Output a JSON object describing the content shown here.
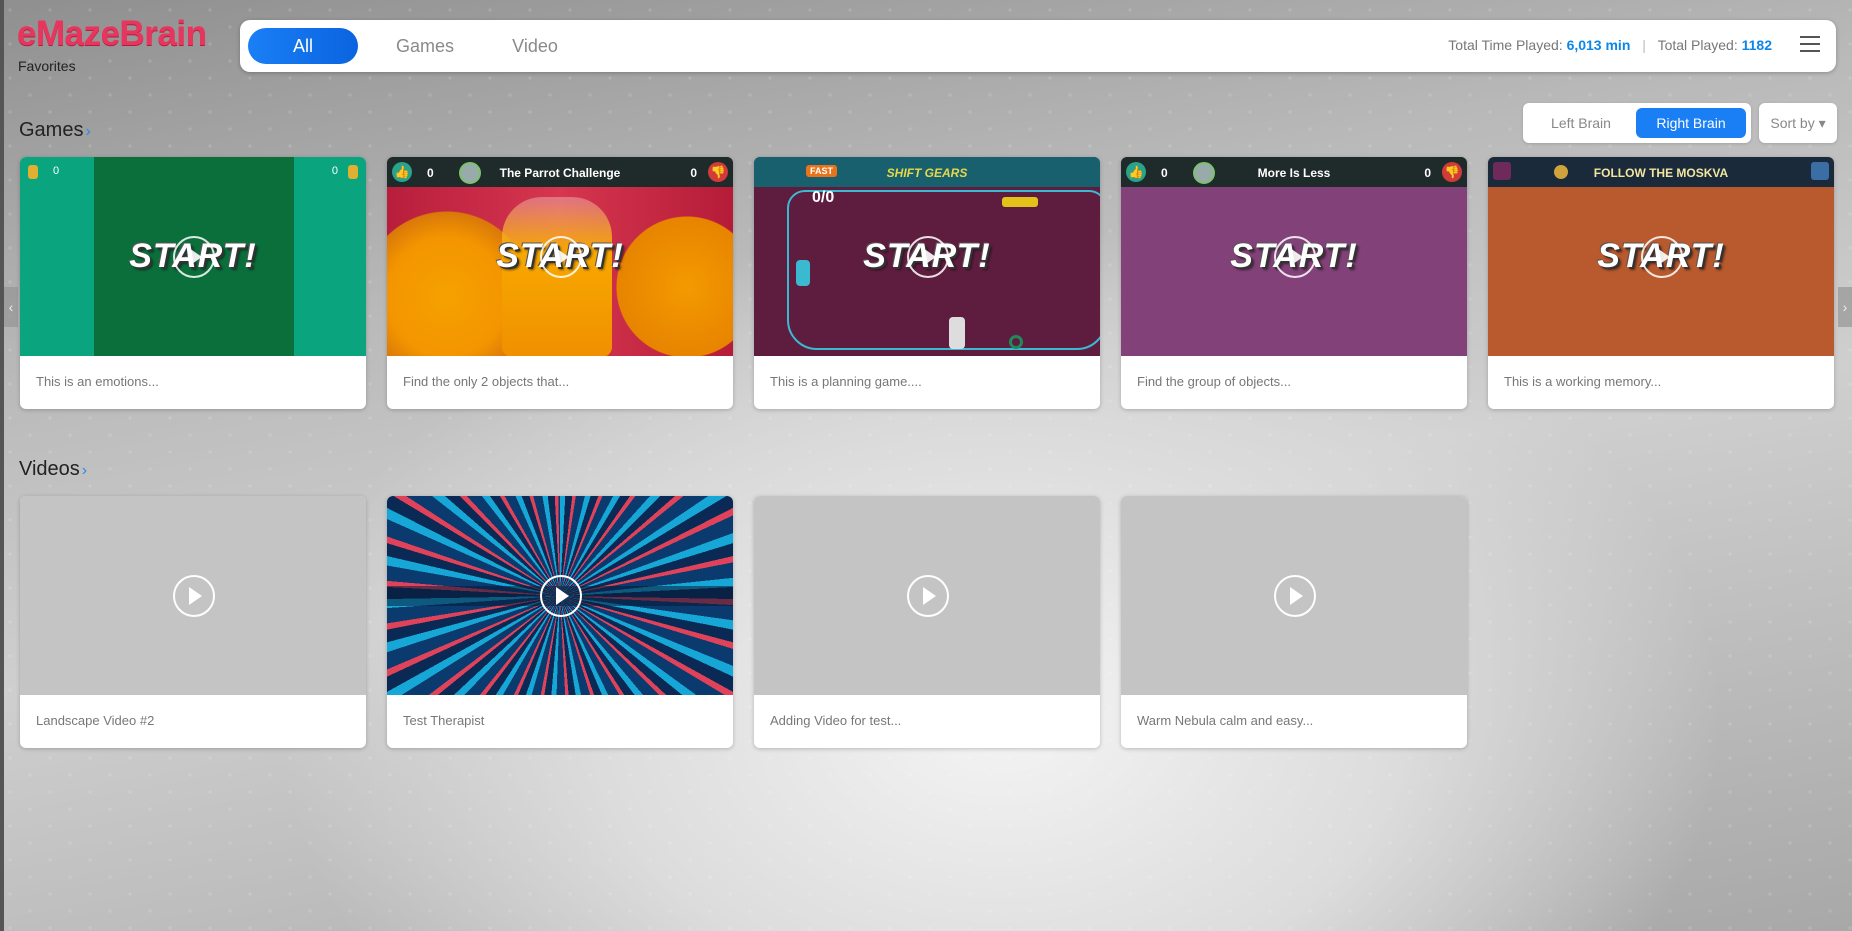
{
  "brand": {
    "logo": "eMazeBrain",
    "subtitle": "Favorites",
    "accent": "#e8355d",
    "primary": "#1a7ff5"
  },
  "nav": {
    "tabs": [
      {
        "label": "All",
        "active": true
      },
      {
        "label": "Games",
        "active": false
      },
      {
        "label": "Video",
        "active": false
      }
    ]
  },
  "stats": {
    "time_label": "Total Time Played:",
    "time_value": "6,013 min",
    "played_label": "Total Played:",
    "played_value": "1182",
    "menu_icon": "hamburger-menu-icon"
  },
  "games": {
    "title": "Games",
    "filters": {
      "left": "Left Brain",
      "right": "Right Brain",
      "active": "Right Brain"
    },
    "sort_label": "Sort by",
    "items": [
      {
        "caption": "This is an emotions...",
        "bar_title": "",
        "left_count": "0",
        "right_count": "0",
        "start": "START!"
      },
      {
        "caption": "Find the only 2 objects that...",
        "bar_title": "The Parrot Challenge",
        "left_count": "0",
        "right_count": "0",
        "start": "START!"
      },
      {
        "caption": "This is a planning game....",
        "bar_title": "SHIFT GEARS",
        "left_count": "",
        "right_count": "",
        "start": "START!",
        "badge": "FAST",
        "counter": "0/0"
      },
      {
        "caption": "Find the group of objects...",
        "bar_title": "More Is Less",
        "left_count": "0",
        "right_count": "0",
        "start": "START!"
      },
      {
        "caption": "This is a working memory...",
        "bar_title": "FOLLOW THE MOSKVA",
        "left_count": "",
        "right_count": "",
        "start": "START!"
      }
    ]
  },
  "videos": {
    "title": "Videos",
    "items": [
      {
        "caption": "Landscape Video #2"
      },
      {
        "caption": "Test Therapist"
      },
      {
        "caption": "Adding Video for test..."
      },
      {
        "caption": "Warm Nebula calm and easy..."
      }
    ]
  }
}
